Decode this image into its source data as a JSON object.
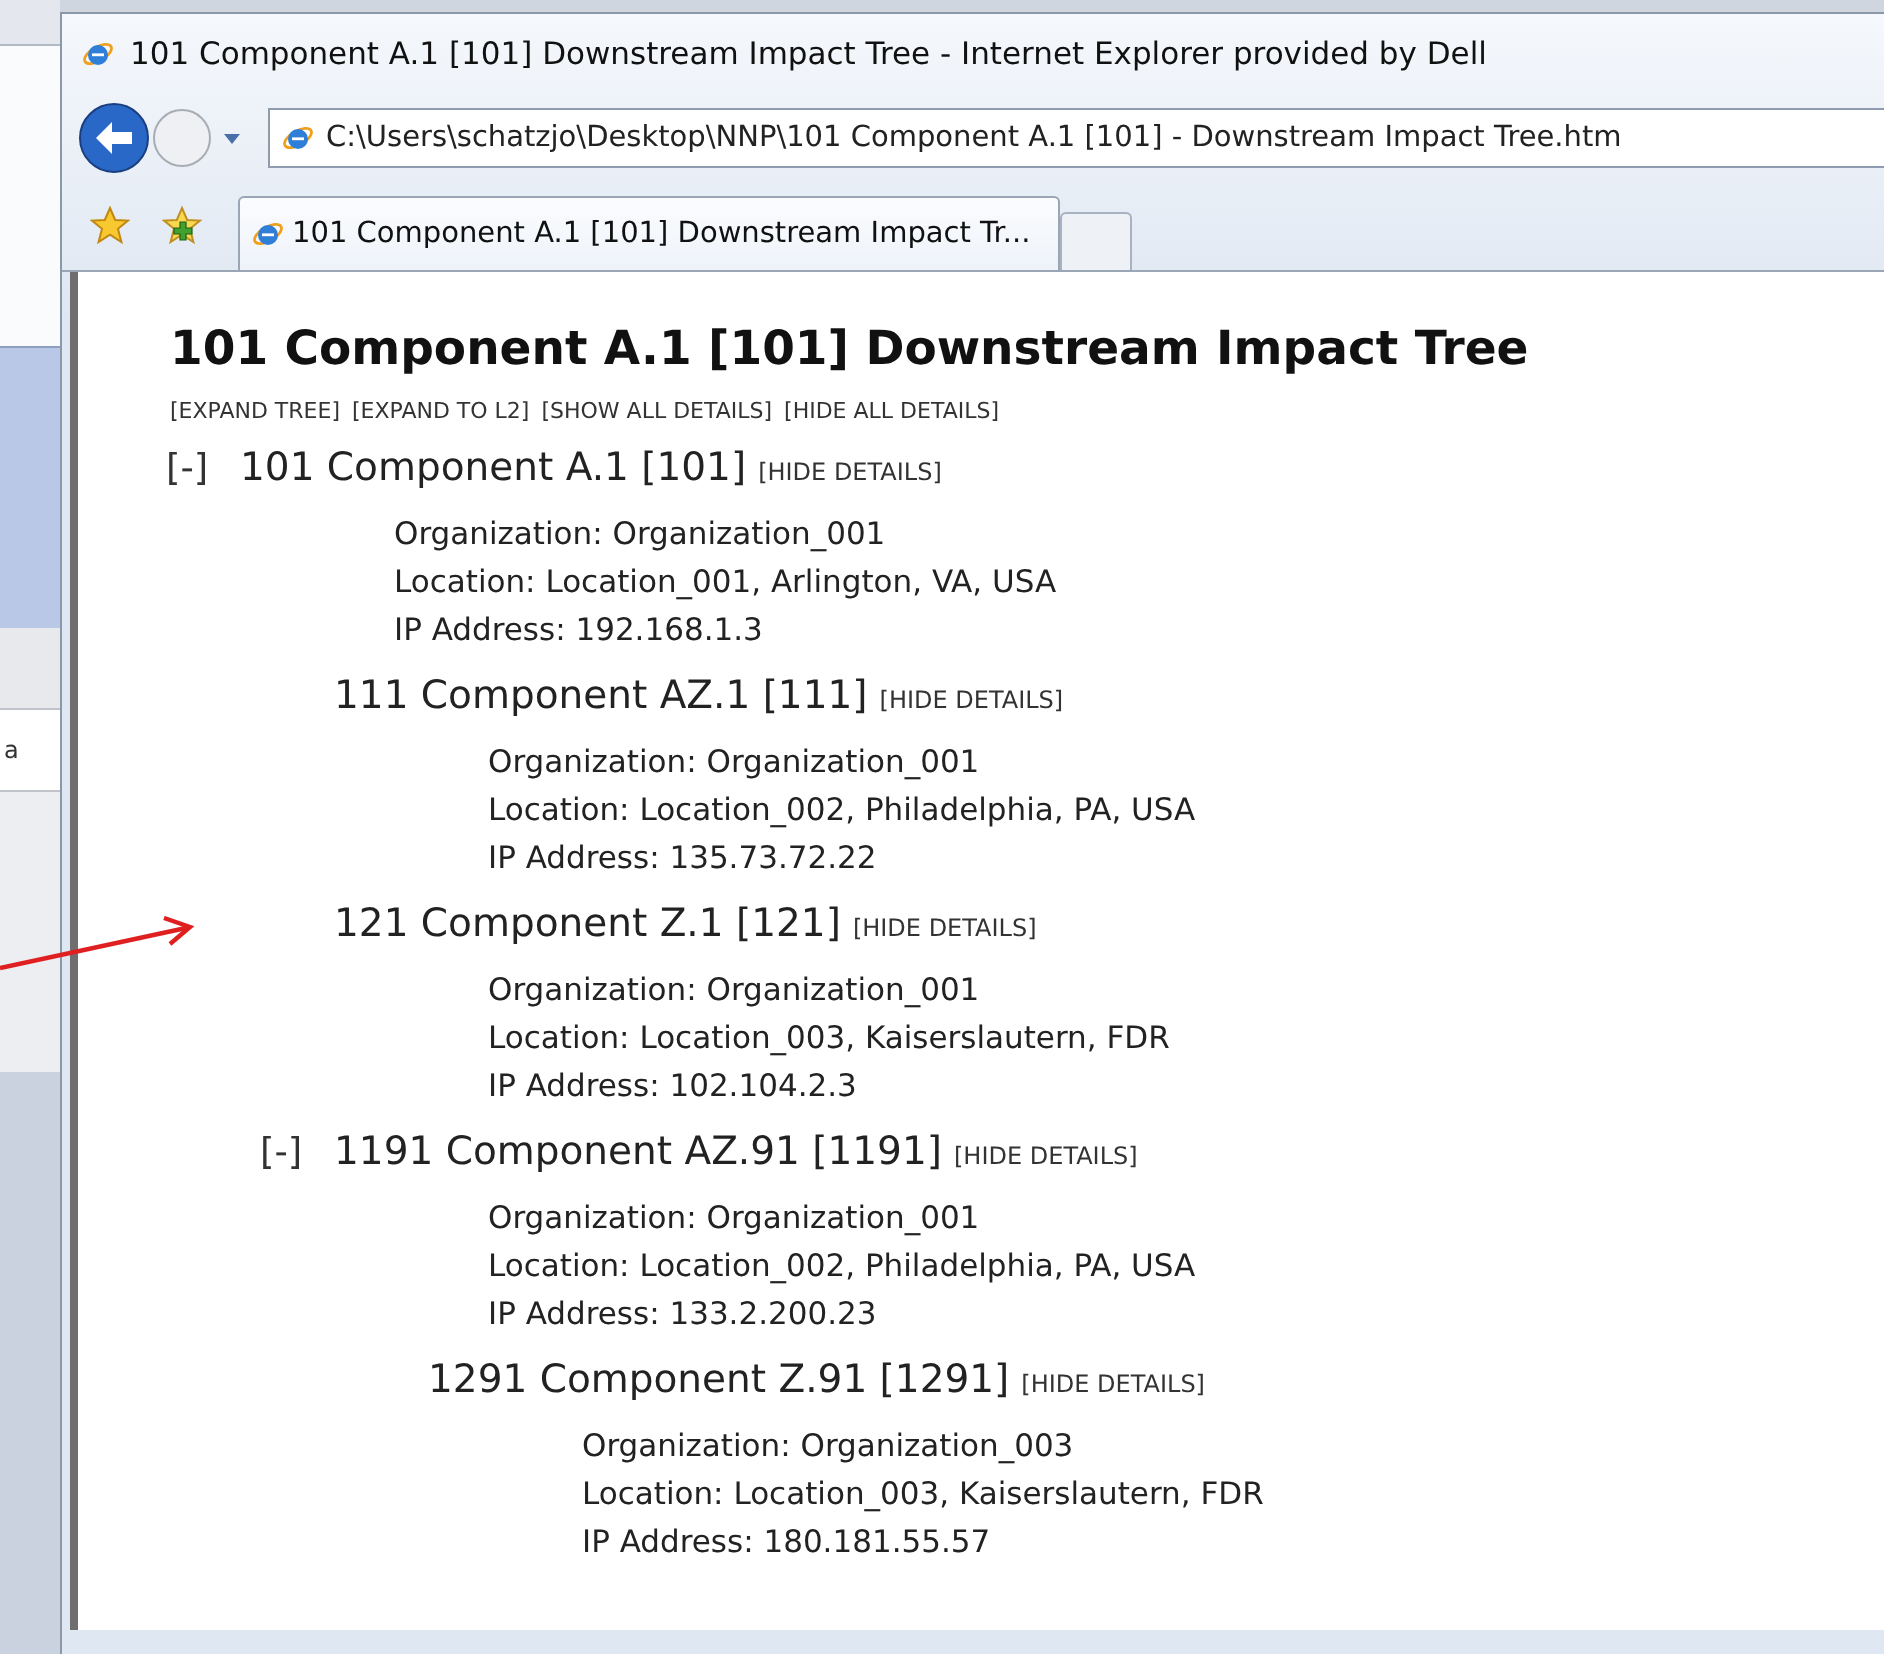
{
  "background_window": {
    "text": "a"
  },
  "window": {
    "title": "101 Component A.1 [101] Downstream Impact Tree - Internet Explorer provided by Dell"
  },
  "address_bar": {
    "value": "C:\\Users\\schatzjo\\Desktop\\NNP\\101 Component A.1 [101] - Downstream Impact Tree.htm"
  },
  "tabs": [
    {
      "label": "101 Component A.1 [101] Downstream Impact Tr...",
      "selected": true
    }
  ],
  "page": {
    "heading": "101 Component A.1 [101] Downstream Impact Tree",
    "actions": [
      "[EXPAND TREE]",
      "[EXPAND TO L2]",
      "[SHOW ALL DETAILS]",
      "[HIDE ALL DETAILS]"
    ],
    "tree": [
      {
        "toggle": "[-]",
        "label": "101 Component A.1 [101]",
        "details_link": "[HIDE DETAILS]",
        "details": [
          "Organization: Organization_001",
          "Location: Location_001, Arlington, VA, USA",
          "IP Address: 192.168.1.3"
        ],
        "children": [
          {
            "label": "111 Component AZ.1 [111]",
            "details_link": "[HIDE DETAILS]",
            "details": [
              "Organization: Organization_001",
              "Location: Location_002, Philadelphia, PA, USA",
              "IP Address: 135.73.72.22"
            ]
          },
          {
            "label": "121 Component Z.1 [121]",
            "details_link": "[HIDE DETAILS]",
            "details": [
              "Organization: Organization_001",
              "Location: Location_003, Kaiserslautern, FDR",
              "IP Address: 102.104.2.3"
            ]
          },
          {
            "toggle": "[-]",
            "label": "1191 Component AZ.91 [1191]",
            "details_link": "[HIDE DETAILS]",
            "details": [
              "Organization: Organization_001",
              "Location: Location_002, Philadelphia, PA, USA",
              "IP Address: 133.2.200.23"
            ],
            "children": [
              {
                "label": "1291 Component Z.91 [1291]",
                "details_link": "[HIDE DETAILS]",
                "details": [
                  "Organization: Organization_003",
                  "Location: Location_003, Kaiserslautern, FDR",
                  "IP Address: 180.181.55.57"
                ]
              }
            ]
          }
        ]
      }
    ]
  }
}
